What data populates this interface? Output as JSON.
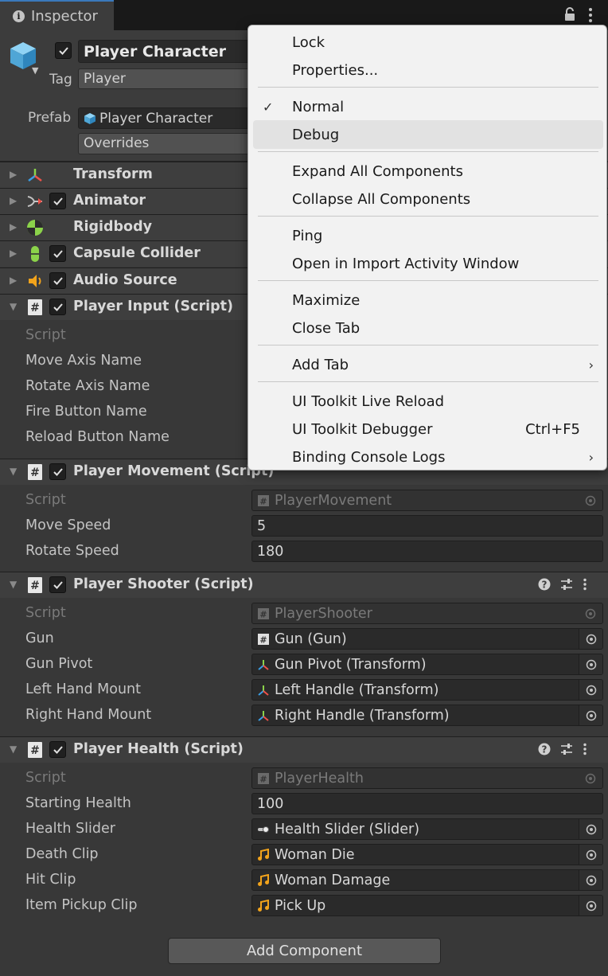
{
  "tab": {
    "title": "Inspector"
  },
  "header": {
    "active": true,
    "name": "Player Character",
    "tag_label": "Tag",
    "tag_value": "Player",
    "prefab_label": "Prefab",
    "prefab_value": "Player Character",
    "overrides_label": "Overrides"
  },
  "components": {
    "transform": {
      "title": "Transform"
    },
    "animator": {
      "title": "Animator"
    },
    "rigidbody": {
      "title": "Rigidbody"
    },
    "capsule": {
      "title": "Capsule Collider"
    },
    "audio": {
      "title": "Audio Source"
    },
    "player_input": {
      "title": "Player Input (Script)",
      "props": {
        "script": "Script",
        "move": "Move Axis Name",
        "rotate": "Rotate Axis Name",
        "fire": "Fire Button Name",
        "reload": "Reload Button Name"
      }
    },
    "player_movement": {
      "title": "Player Movement (Script)",
      "props": {
        "script": "Script",
        "script_value": "PlayerMovement",
        "move_speed": "Move Speed",
        "move_speed_value": "5",
        "rotate_speed": "Rotate Speed",
        "rotate_speed_value": "180"
      }
    },
    "player_shooter": {
      "title": "Player Shooter (Script)",
      "props": {
        "script": "Script",
        "script_value": "PlayerShooter",
        "gun": "Gun",
        "gun_value": "Gun (Gun)",
        "gun_pivot": "Gun Pivot",
        "gun_pivot_value": "Gun Pivot (Transform)",
        "left_hand": "Left Hand Mount",
        "left_hand_value": "Left Handle (Transform)",
        "right_hand": "Right Hand Mount",
        "right_hand_value": "Right Handle (Transform)"
      }
    },
    "player_health": {
      "title": "Player Health (Script)",
      "props": {
        "script": "Script",
        "script_value": "PlayerHealth",
        "starting_health": "Starting Health",
        "starting_health_value": "100",
        "health_slider": "Health Slider",
        "health_slider_value": "Health Slider (Slider)",
        "death_clip": "Death Clip",
        "death_clip_value": "Woman Die",
        "hit_clip": "Hit Clip",
        "hit_clip_value": "Woman Damage",
        "pickup_clip": "Item Pickup Clip",
        "pickup_clip_value": "Pick Up"
      }
    }
  },
  "add_component": "Add Component",
  "menu": {
    "lock": "Lock",
    "properties": "Properties...",
    "normal": "Normal",
    "normal_checked": true,
    "debug": "Debug",
    "expand_all": "Expand All Components",
    "collapse_all": "Collapse All Components",
    "ping": "Ping",
    "open_import": "Open in Import Activity Window",
    "maximize": "Maximize",
    "close_tab": "Close Tab",
    "add_tab": "Add Tab",
    "uitk_reload": "UI Toolkit Live Reload",
    "uitk_debugger": "UI Toolkit Debugger",
    "uitk_debugger_shortcut": "Ctrl+F5",
    "binding_logs": "Binding Console Logs"
  },
  "colors": {
    "tab_accent": "#3a79bb",
    "panel_bg": "#383838",
    "menu_bg": "#f2f2f2",
    "menu_highlight": "#e2e2e2"
  }
}
